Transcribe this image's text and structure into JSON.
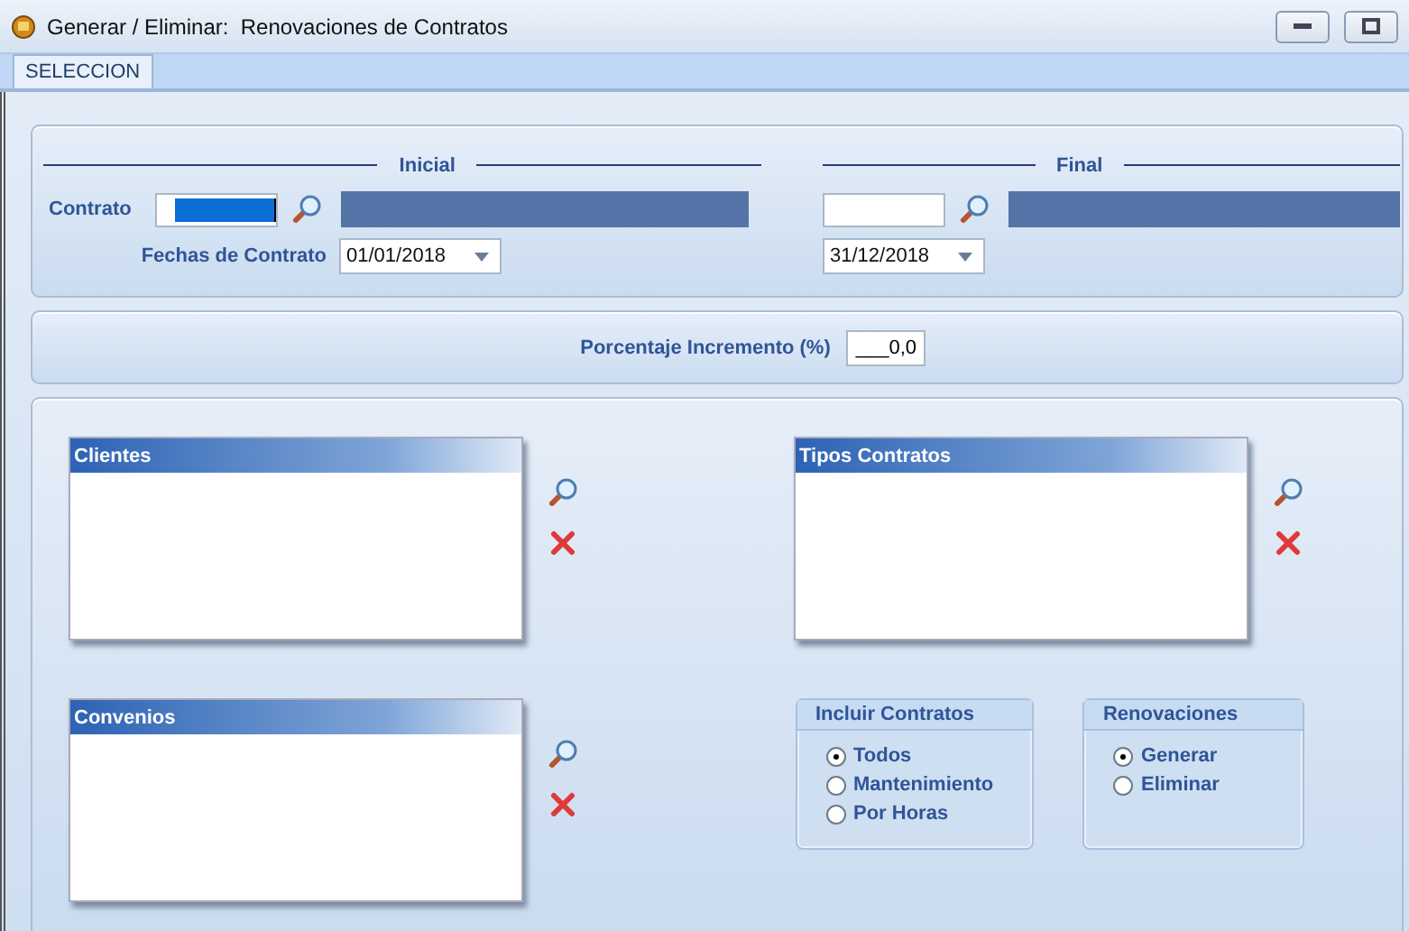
{
  "window": {
    "title": "Generar / Eliminar:  Renovaciones de Contratos"
  },
  "tabs": [
    {
      "label": "SELECCION",
      "selected": true
    }
  ],
  "range": {
    "contrato_label": "Contrato",
    "fechas_label": "Fechas  de Contrato",
    "inicial": {
      "heading": "Inicial",
      "contrato_highlighted": true,
      "fecha": "01/01/2018"
    },
    "final": {
      "heading": "Final",
      "contrato_highlighted": false,
      "fecha": "31/12/2018"
    }
  },
  "incremento": {
    "label": "Porcentaje Incremento (%)",
    "value": "___0,0"
  },
  "lists": [
    {
      "title": "Clientes"
    },
    {
      "title": "Tipos Contratos"
    },
    {
      "title": "Convenios"
    }
  ],
  "option_groups": [
    {
      "title": "Incluir Contratos",
      "options": [
        {
          "label": "Todos",
          "selected": true
        },
        {
          "label": "Mantenimiento",
          "selected": false
        },
        {
          "label": "Por Horas",
          "selected": false
        }
      ]
    },
    {
      "title": "Renovaciones",
      "options": [
        {
          "label": "Generar",
          "selected": true
        },
        {
          "label": "Eliminar",
          "selected": false
        }
      ]
    }
  ]
}
